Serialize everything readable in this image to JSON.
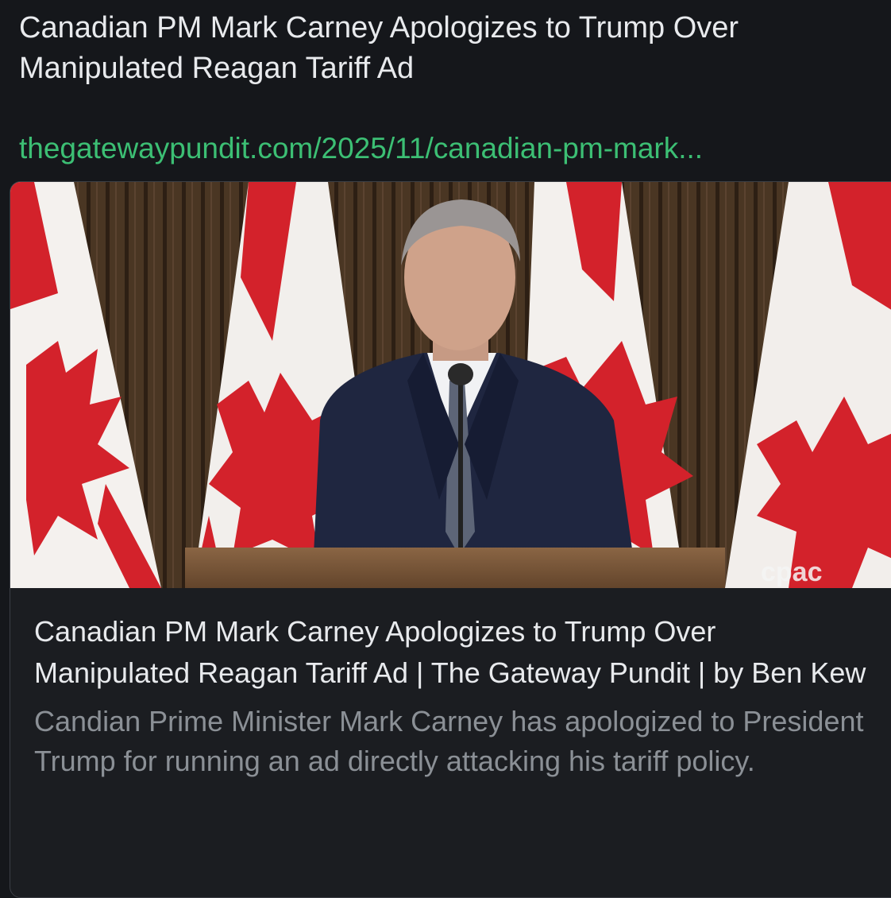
{
  "post": {
    "text": "Canadian PM Mark Carney Apologizes to Trump Over Manipulated Reagan Tariff Ad",
    "link_text": "thegatewaypundit.com/2025/11/canadian-pm-mark..."
  },
  "card": {
    "image_watermark": "cpac",
    "title": "Canadian PM Mark Carney Apologizes to Trump Over Manipulated Reagan Tariff Ad | The Gateway Pundit | by Ben Kew",
    "description": "Candian Prime Minister Mark Carney has apologized to President Trump for running an ad directly attacking his tariff policy."
  },
  "colors": {
    "background": "#15171b",
    "link": "#3cbf74",
    "title_text": "#e8eaed",
    "description_text": "#8b9096",
    "flag_red": "#d3222b"
  }
}
